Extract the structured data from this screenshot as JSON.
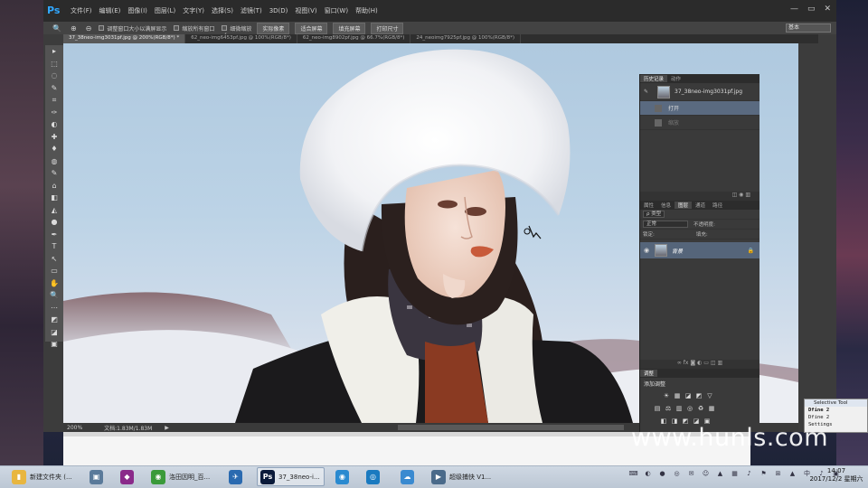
{
  "app": {
    "logo": "Ps",
    "menu": [
      "文件(F)",
      "编辑(E)",
      "图像(I)",
      "图层(L)",
      "文字(Y)",
      "选择(S)",
      "滤镜(T)",
      "3D(D)",
      "视图(V)",
      "窗口(W)",
      "帮助(H)"
    ],
    "window_controls": [
      "—",
      "▭",
      "✕"
    ]
  },
  "options": {
    "zoom_icon": "magnifier-icon",
    "check1_label": "调整窗口大小以满屏显示",
    "check2_label": "缩放所有窗口",
    "check3_label": "细微缩放",
    "btn_actual": "实际像素",
    "btn_fit": "适合屏幕",
    "btn_fill": "填充屏幕",
    "btn_print": "打印尺寸",
    "workspace": "基本"
  },
  "tabs": [
    "37_38neo-img3031pf.jpg @ 200%(RGB/8*) *",
    "62_neo-img6453pf.jpg @ 100%(RGB/8*)",
    "62_neo-img8902pf.jpg @ 66.7%(RGB/8*)",
    "24_neoimg7925pf.jpg @ 100%(RGB/8*)"
  ],
  "tools": [
    "▸",
    "⬚",
    "◌",
    "✎",
    "⌗",
    "✑",
    "◐",
    "✚",
    "♦",
    "◍",
    "✎",
    "⌂",
    "◧",
    "◭",
    "●",
    "✒",
    "T",
    "↖",
    "▭",
    "✋",
    "🔍",
    "⋯",
    "◩",
    "◪",
    "▣"
  ],
  "status": {
    "zoom": "200%",
    "doc": "文档:1.83M/1.83M",
    "arrow": "▶"
  },
  "history": {
    "tabs": [
      "历史记录",
      "动作"
    ],
    "snapshot": "37_38neo-img3031pf.jpg",
    "open": "打开",
    "next": "缩放"
  },
  "layers": {
    "tabs": [
      "属性",
      "信息",
      "图层",
      "通道",
      "路径"
    ],
    "kind": "ρ 类型",
    "blend": "正常",
    "opacity": "不透明度:",
    "lock": "锁定:",
    "fill": "填充:",
    "layer_name": "背景"
  },
  "adjustments": {
    "tab": "调整",
    "title": "添加调整",
    "icons_row1": [
      "☀",
      "▦",
      "◪",
      "◩",
      "▽"
    ],
    "icons_row2": [
      "▤",
      "⚖",
      "▥",
      "◎",
      "♻",
      "▦"
    ],
    "icons_row3": [
      "◧",
      "◨",
      "◩",
      "◪",
      "▣"
    ]
  },
  "selective_tool": {
    "title": "Selective Tool",
    "line1": "Dfine 2",
    "line2": "Dfine 2",
    "line3": "Settings"
  },
  "watermark": "www.hunls.com",
  "taskbar": {
    "items": [
      {
        "label": "新建文件夹 (...",
        "color": "#e8b640",
        "glyph": "▮"
      },
      {
        "label": "",
        "color": "#5a7a9a",
        "glyph": "▣"
      },
      {
        "label": "",
        "color": "#8a2a8a",
        "glyph": "◆"
      },
      {
        "label": "洛田因明_百...",
        "color": "#3a9a3a",
        "glyph": "◉"
      },
      {
        "label": "",
        "color": "#2a6ab0",
        "glyph": "✈"
      },
      {
        "label": "37_38neo-i...",
        "color": "#0a1a3a",
        "glyph": "Ps"
      },
      {
        "label": "",
        "color": "#2a8ad0",
        "glyph": "◉"
      },
      {
        "label": "",
        "color": "#1a7ac0",
        "glyph": "◎"
      },
      {
        "label": "",
        "color": "#3a8ad0",
        "glyph": "☁"
      },
      {
        "label": "超级捕快 V1...",
        "color": "#4a6a8a",
        "glyph": "▶"
      }
    ],
    "tray": [
      "⌨",
      "◐",
      "●",
      "◎",
      "✉",
      "☺",
      "▲",
      "▦",
      "♪",
      "⚑",
      "⊞",
      "▲",
      "中",
      "♪",
      "▣"
    ],
    "time": "14:07",
    "date": "2017/12/2 星期六"
  }
}
